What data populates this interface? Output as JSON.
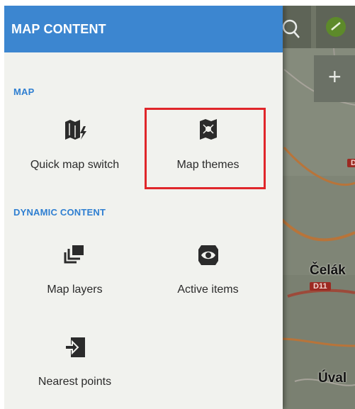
{
  "drawer": {
    "title": "MAP CONTENT",
    "sections": [
      {
        "title": "MAP",
        "items": [
          {
            "label": "Quick map switch",
            "icon": "quick-map-switch-icon"
          },
          {
            "label": "Map themes",
            "icon": "map-themes-icon",
            "highlighted": true
          }
        ]
      },
      {
        "title": "DYNAMIC CONTENT",
        "items": [
          {
            "label": "Map layers",
            "icon": "map-layers-icon"
          },
          {
            "label": "Active items",
            "icon": "active-items-icon"
          },
          {
            "label": "Nearest points",
            "icon": "nearest-points-icon"
          }
        ]
      }
    ]
  },
  "map": {
    "labels": [
      "Čelák",
      "Úval"
    ],
    "road_badges": [
      "D11",
      "D"
    ],
    "buttons": {
      "zoom_in_icon": "+",
      "search_icon": "search-icon",
      "gps_icon": "gps-icon"
    }
  },
  "colors": {
    "header": "#3c86d0",
    "section_title": "#2f7fd1",
    "drawer_bg": "#f1f2ee",
    "highlight": "#e0262a"
  }
}
